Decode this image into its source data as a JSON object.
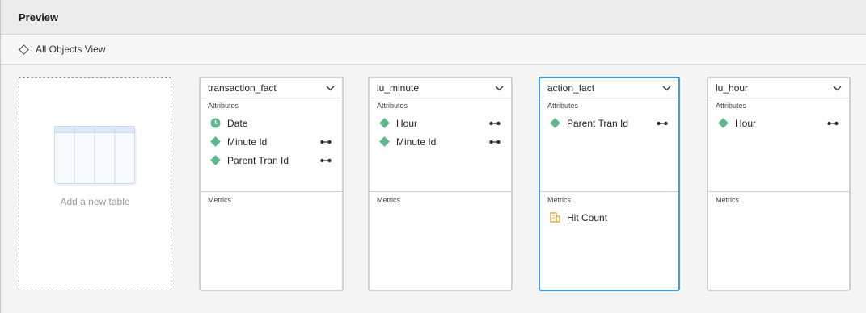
{
  "dialog": {
    "title": "Preview"
  },
  "viewbar": {
    "label": "All Objects View"
  },
  "add_table": {
    "label": "Add a new table"
  },
  "colors": {
    "selected_border": "#3a9ad9",
    "attribute_icon": "#5cb98c",
    "metric_icon": "#e0a030"
  },
  "cards": [
    {
      "title": "transaction_fact",
      "attributes_label": "Attributes",
      "attributes": [
        {
          "label": "Date",
          "icon": "clock-icon"
        },
        {
          "label": "Minute Id",
          "icon": "attribute-icon"
        },
        {
          "label": "Parent Tran Id",
          "icon": "attribute-icon"
        }
      ],
      "metrics_label": "Metrics",
      "metrics": []
    },
    {
      "title": "lu_minute",
      "attributes_label": "Attributes",
      "attributes": [
        {
          "label": "Hour",
          "icon": "attribute-icon"
        },
        {
          "label": "Minute Id",
          "icon": "attribute-icon"
        }
      ],
      "metrics_label": "Metrics",
      "metrics": []
    },
    {
      "title": "action_fact",
      "attributes_label": "Attributes",
      "attributes": [
        {
          "label": "Parent Tran Id",
          "icon": "attribute-icon"
        }
      ],
      "metrics_label": "Metrics",
      "metrics": [
        {
          "label": "Hit Count",
          "icon": "metric-icon"
        }
      ]
    },
    {
      "title": "lu_hour",
      "attributes_label": "Attributes",
      "attributes": [
        {
          "label": "Hour",
          "icon": "attribute-icon"
        }
      ],
      "metrics_label": "Metrics",
      "metrics": []
    }
  ]
}
